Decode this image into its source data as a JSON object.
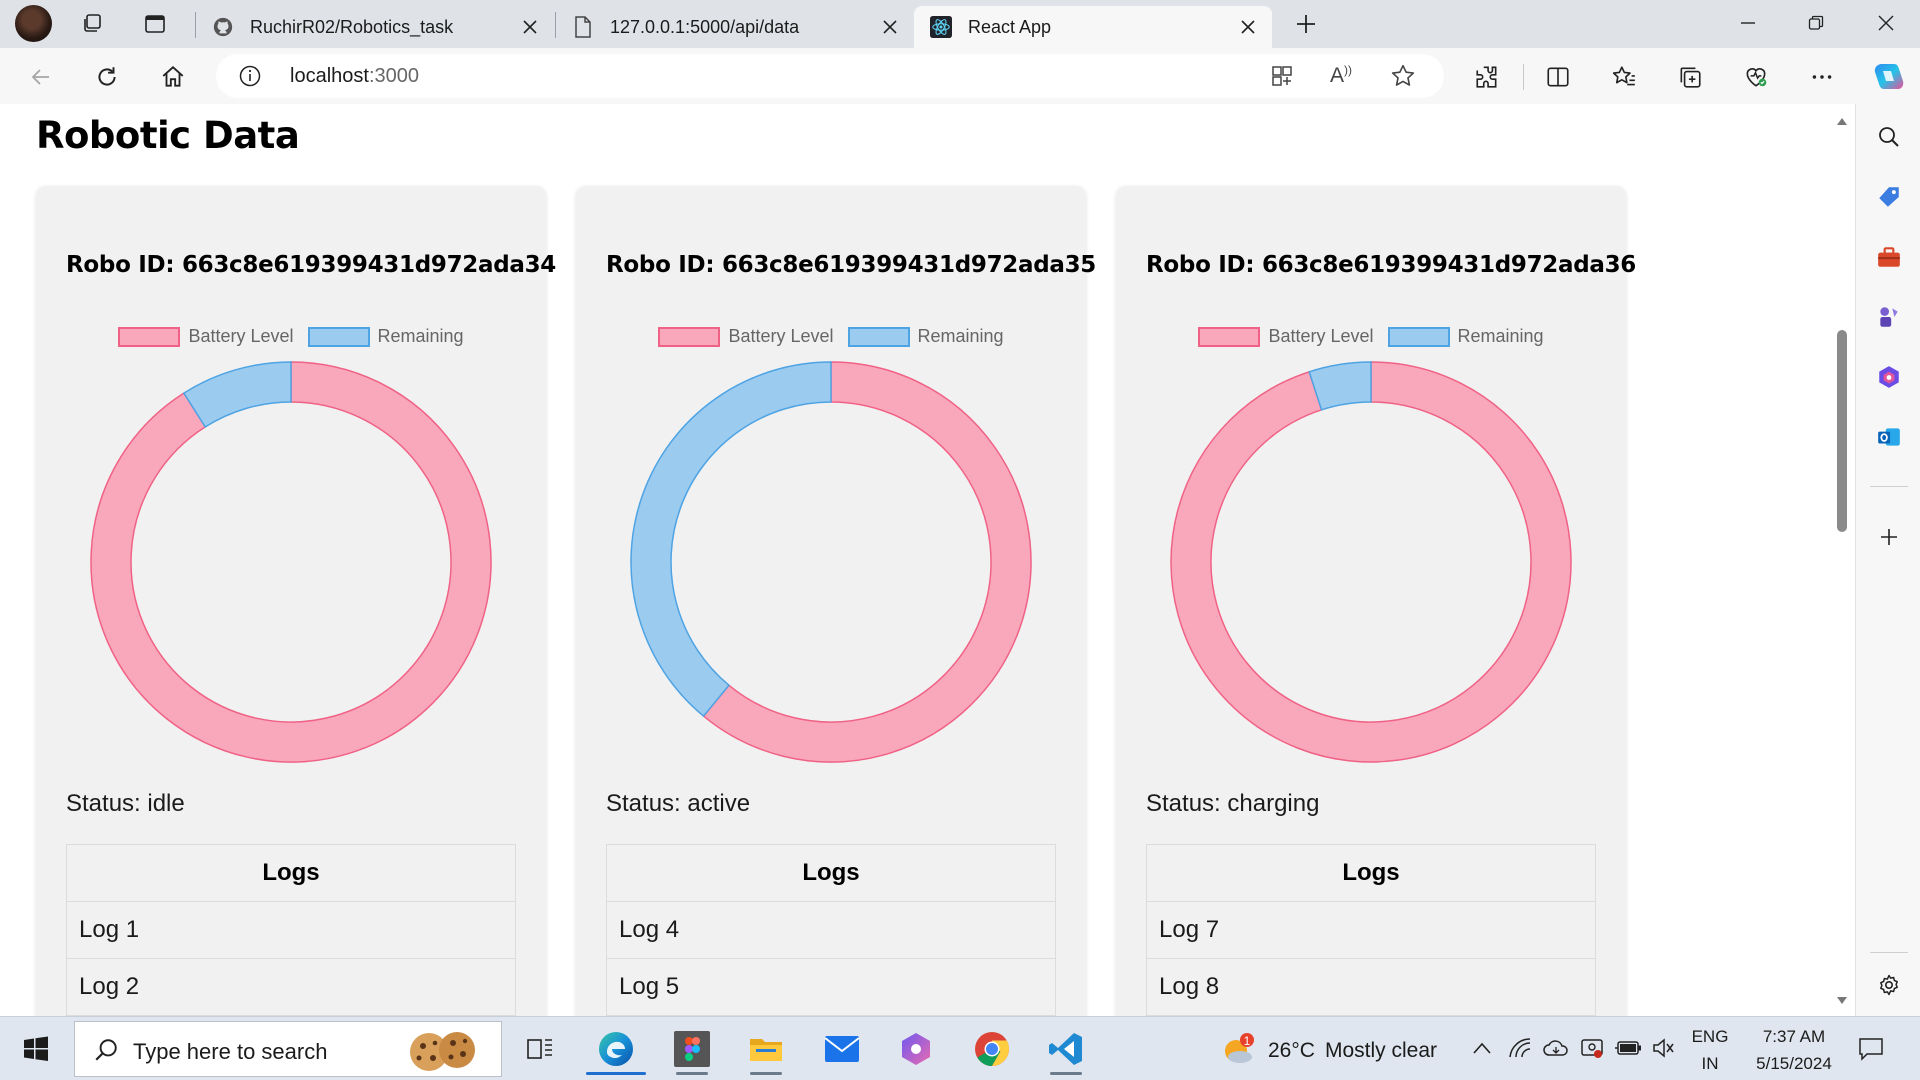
{
  "browser": {
    "tabs": [
      {
        "title": "RuchirR02/Robotics_task",
        "icon": "github-icon",
        "active": false
      },
      {
        "title": "127.0.0.1:5000/api/data",
        "icon": "file-icon",
        "active": false
      },
      {
        "title": "React App",
        "icon": "react-icon",
        "active": true
      }
    ],
    "address": {
      "host": "localhost",
      "port": ":3000"
    }
  },
  "page": {
    "title": "Robotic Data",
    "legend": {
      "battery": "Battery Level",
      "remaining": "Remaining"
    },
    "logs_header": "Logs",
    "robots": [
      {
        "id_text": "Robo ID: 663c8e619399431d972ada34",
        "status_text": "Status: idle",
        "battery_level": 91,
        "logs": [
          "Log 1",
          "Log 2"
        ]
      },
      {
        "id_text": "Robo ID: 663c8e619399431d972ada35",
        "status_text": "Status: active",
        "battery_level": 61,
        "logs": [
          "Log 4",
          "Log 5"
        ]
      },
      {
        "id_text": "Robo ID: 663c8e619399431d972ada36",
        "status_text": "Status: charging",
        "battery_level": 95,
        "logs": [
          "Log 7",
          "Log 8"
        ]
      }
    ],
    "colors": {
      "battery_fill": "#f9a8bc",
      "battery_border": "#f06285",
      "remaining_fill": "#9ccbf0",
      "remaining_border": "#4ea3e3"
    }
  },
  "taskbar": {
    "search_placeholder": "Type here to search",
    "weather": {
      "temp": "26°C",
      "condition": "Mostly clear",
      "alert_count": "1"
    },
    "language": {
      "lang": "ENG",
      "region": "IN"
    },
    "clock": {
      "time": "7:37 AM",
      "date": "5/15/2024"
    },
    "apps": [
      "task-view-icon",
      "edge-icon",
      "figma-icon",
      "file-explorer-icon",
      "mail-icon",
      "copilot-icon",
      "chrome-icon",
      "vscode-icon"
    ]
  }
}
